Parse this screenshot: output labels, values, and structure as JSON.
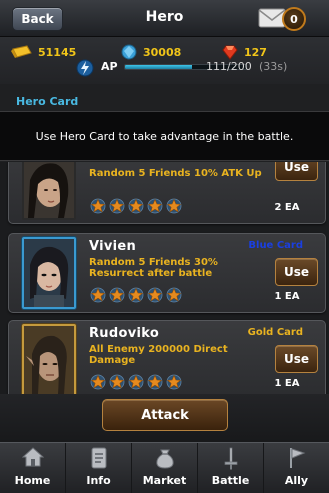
{
  "header": {
    "back_label": "Back",
    "title": "Hero",
    "mail_count": "0"
  },
  "resources": {
    "gold": "51145",
    "gems": "30008",
    "rubies": "127",
    "ap_label": "AP",
    "ap_value": "111/200",
    "ap_fraction": 0.555,
    "ap_timer": "(33s)"
  },
  "section": {
    "title": "Hero Card",
    "description": "Use Hero Card to take advantage in the battle."
  },
  "cards": [
    {
      "name": "",
      "grade": "",
      "effect": "Random 5 Friends 10% ATK Up",
      "use_label": "Use",
      "quantity": "2 EA",
      "stars": 5
    },
    {
      "name": "Vivien",
      "grade": "Blue Card",
      "grade_color": "#1a3fe0",
      "effect": "Random 5 Friends 30% Resurrect after battle",
      "use_label": "Use",
      "quantity": "1 EA",
      "stars": 5
    },
    {
      "name": "Rudoviko",
      "grade": "Gold Card",
      "grade_color": "#e9b320",
      "effect": "All Enemy 200000 Direct Damage",
      "use_label": "Use",
      "quantity": "1 EA",
      "stars": 5
    }
  ],
  "attack_label": "Attack",
  "nav": {
    "home": "Home",
    "info": "Info",
    "market": "Market",
    "battle": "Battle",
    "ally": "Ally"
  },
  "colors": {
    "accent_blue": "#49b9e2",
    "gold_text": "#e9b320"
  }
}
